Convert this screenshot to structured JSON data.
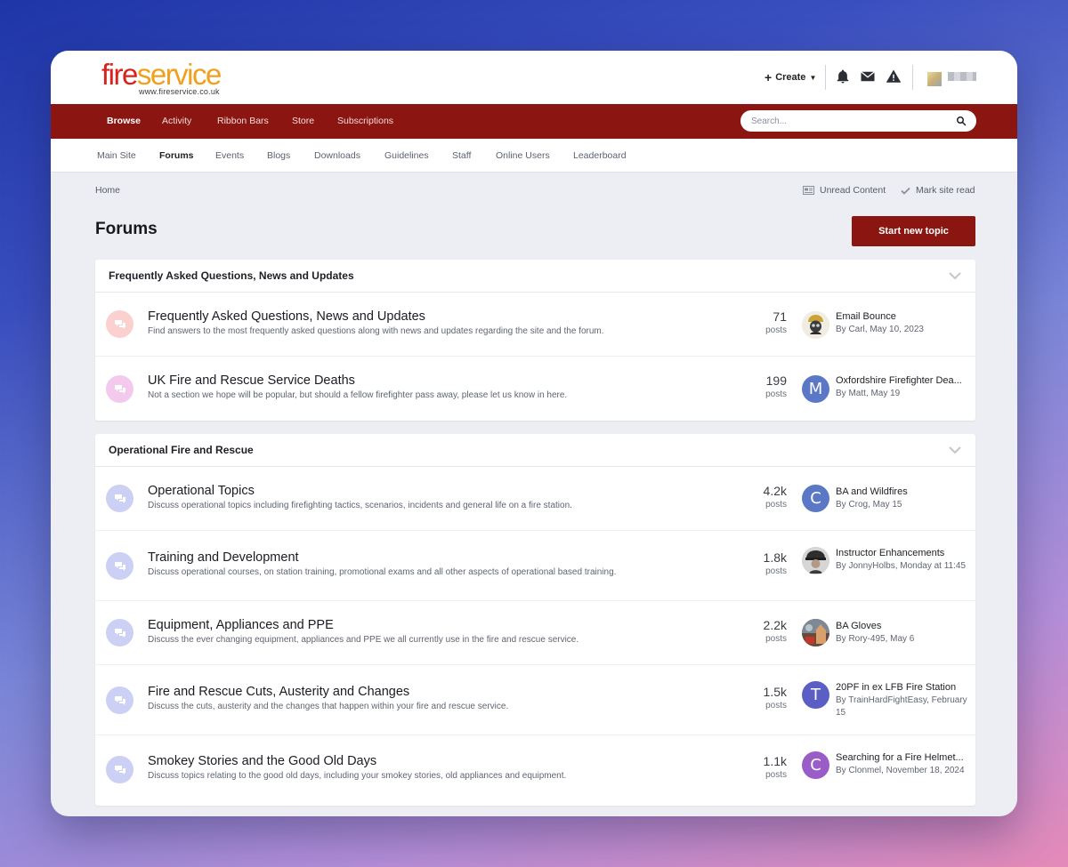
{
  "brand": {
    "logo_fire": "fire",
    "logo_service": "service",
    "logo_url": "www.fireservice.co.uk",
    "accent_color": "#8b1510"
  },
  "header": {
    "create_label": "Create",
    "icons": [
      "bell-icon",
      "envelope-icon",
      "warning-icon"
    ]
  },
  "primary_nav": {
    "items": [
      {
        "label": "Browse",
        "active": true
      },
      {
        "label": "Activity"
      },
      {
        "label": "Ribbon Bars"
      },
      {
        "label": "Store"
      },
      {
        "label": "Subscriptions"
      }
    ],
    "search_placeholder": "Search..."
  },
  "secondary_nav": {
    "items": [
      {
        "label": "Main Site"
      },
      {
        "label": "Forums",
        "active": true
      },
      {
        "label": "Events"
      },
      {
        "label": "Blogs"
      },
      {
        "label": "Downloads"
      },
      {
        "label": "Guidelines"
      },
      {
        "label": "Staff"
      },
      {
        "label": "Online Users"
      },
      {
        "label": "Leaderboard"
      }
    ]
  },
  "breadcrumb": {
    "home": "Home"
  },
  "actions": {
    "unread_content": "Unread Content",
    "mark_site_read": "Mark site read"
  },
  "page": {
    "title": "Forums",
    "start_topic": "Start new topic"
  },
  "categories": [
    {
      "title": "Frequently Asked Questions, News and Updates",
      "forums": [
        {
          "title": "Frequently Asked Questions, News and Updates",
          "description": "Find answers to the most frequently asked questions along with news and updates regarding the site and the forum.",
          "posts": "71",
          "posts_label": "posts",
          "last_title": "Email Bounce",
          "last_by": "By Carl, May 10, 2023",
          "icon_bg": "#fbd1cf",
          "avatar": {
            "type": "photo",
            "letter": "",
            "color": "#9a8a5a"
          }
        },
        {
          "title": "UK Fire and Rescue Service Deaths",
          "description": "Not a section we hope will be popular, but should a fellow firefighter pass away, please let us know in here.",
          "posts": "199",
          "posts_label": "posts",
          "last_title": "Oxfordshire Firefighter Dea...",
          "last_by": "By Matt, May 19",
          "icon_bg": "#f4c9ee",
          "avatar": {
            "type": "letter",
            "letter": "M",
            "color": "#5a78c6"
          }
        }
      ]
    },
    {
      "title": "Operational Fire and Rescue",
      "forums": [
        {
          "title": "Operational Topics",
          "description": "Discuss operational topics including firefighting tactics, scenarios, incidents and general life on a fire station.",
          "posts": "4.2k",
          "posts_label": "posts",
          "last_title": "BA and Wildfires",
          "last_by": "By Crog, May 15",
          "icon_bg": "#ccd0f5",
          "avatar": {
            "type": "letter",
            "letter": "C",
            "color": "#5a78c6"
          }
        },
        {
          "title": "Training and Development",
          "description": "Discuss operational courses, on station training, promotional exams and all other aspects of operational based training.",
          "posts": "1.8k",
          "posts_label": "posts",
          "last_title": "Instructor Enhancements",
          "last_by": "By JonnyHolbs, Monday at 11:45",
          "icon_bg": "#ccd0f5",
          "avatar": {
            "type": "photo",
            "letter": "",
            "color": "#6d6d6d"
          }
        },
        {
          "title": "Equipment, Appliances and PPE",
          "description": "Discuss the ever changing equipment, appliances and PPE we all currently use in the fire and rescue service.",
          "posts": "2.2k",
          "posts_label": "posts",
          "last_title": "BA Gloves",
          "last_by": "By Rory-495, May 6",
          "icon_bg": "#ccd0f5",
          "avatar": {
            "type": "photo",
            "letter": "",
            "color": "#a4735a"
          }
        },
        {
          "title": "Fire and Rescue Cuts, Austerity and Changes",
          "description": "Discuss the cuts, austerity and the changes that happen within your fire and rescue service.",
          "posts": "1.5k",
          "posts_label": "posts",
          "last_title": "20PF in ex LFB Fire Station",
          "last_by": "By TrainHardFightEasy, February 15",
          "icon_bg": "#ccd0f5",
          "avatar": {
            "type": "letter",
            "letter": "T",
            "color": "#5b5fc4"
          }
        },
        {
          "title": "Smokey Stories and the Good Old Days",
          "description": "Discuss topics relating to the good old days, including your smokey stories, old appliances and equipment.",
          "posts": "1.1k",
          "posts_label": "posts",
          "last_title": "Searching for a Fire Helmet...",
          "last_by": "By Clonmel, November 18, 2024",
          "icon_bg": "#ccd0f5",
          "avatar": {
            "type": "letter",
            "letter": "C",
            "color": "#9a5cc7"
          }
        }
      ]
    }
  ]
}
